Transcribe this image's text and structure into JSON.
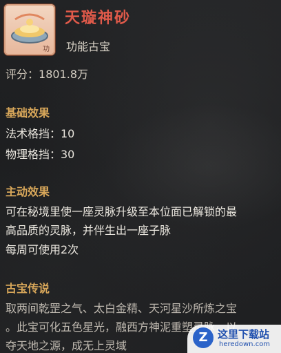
{
  "item": {
    "name": "天璇神砂",
    "type": "功能古宝",
    "icon_text": "功"
  },
  "rating": {
    "label": "评分：",
    "value": "1801.8万"
  },
  "basic_effects": {
    "title": "基础效果",
    "lines": [
      "法术格挡：10",
      "物理格挡：30"
    ]
  },
  "active_effect": {
    "title": "主动效果",
    "lines": [
      "可在秘境里使一座灵脉升级至本位面已解锁的最",
      "高品质的灵脉，并伴生出一座子脉",
      "每周可使用2次"
    ]
  },
  "lore": {
    "title": "古宝传说",
    "lines": [
      "取两间乾罡之气、太白金精、天河星沙所炼之宝",
      "。此宝可化五色星光，融西方神泥重塑灵脉，以",
      "夺天地之源，成无上灵域"
    ]
  },
  "watermark": {
    "logo": "Z",
    "title": "这里下载站",
    "url": "heredown.com"
  },
  "colors": {
    "name": "#e05a4a",
    "section_title": "#d8a75a",
    "text": "#ece8e0"
  }
}
